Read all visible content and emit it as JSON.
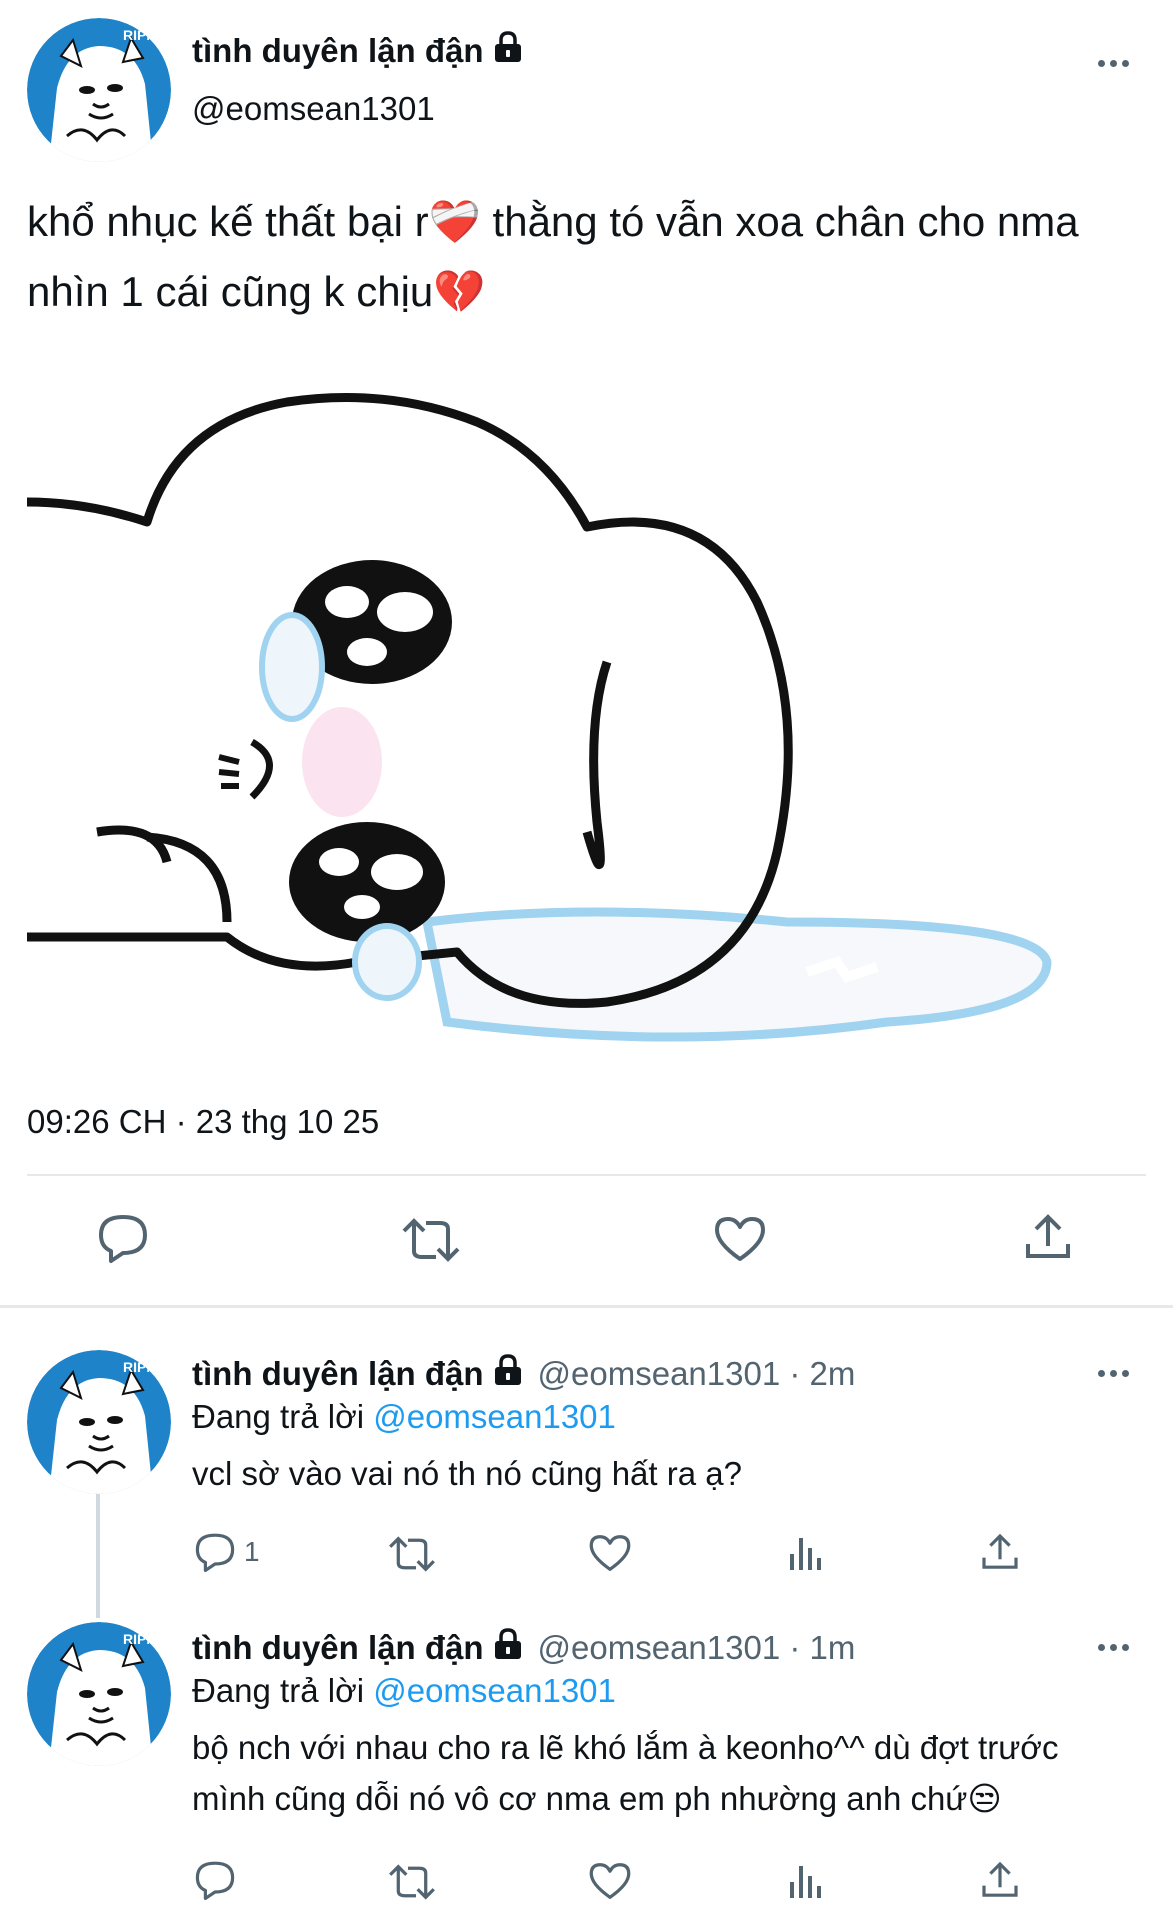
{
  "main_tweet": {
    "display_name": "tình duyên lận đận",
    "handle": "@eomsean1301",
    "avatar_text": "RIPN",
    "text_line1": "khổ nhục kế thất bại r❤️‍🩹 thằng tó vẫn xoa chân cho nma",
    "text_line2": "nhìn 1 cái cũng k chịu💔",
    "timestamp": "09:26 CH · 23 thg 10 25"
  },
  "replies": [
    {
      "display_name": "tình duyên lận đận",
      "handle_time": "@eomsean1301 · 2m",
      "replying_prefix": "Đang trả lời",
      "replying_to": "@eomsean1301",
      "text_line1": "vcl sờ vào vai nó th nó cũng hất ra ạ?",
      "text_line2": "",
      "reply_count": "1"
    },
    {
      "display_name": "tình duyên lận đận",
      "handle_time": "@eomsean1301 · 1m",
      "replying_prefix": "Đang trả lời",
      "replying_to": "@eomsean1301",
      "text_line1": "bộ nch với nhau cho ra lẽ khó lắm à keonho^^ dù đợt trước",
      "text_line2": "mình cũng dỗi nó vô cơ nma em ph nhường anh chứ😒",
      "reply_count": ""
    }
  ],
  "icons": {
    "reply": "reply-icon",
    "retweet": "retweet-icon",
    "like": "heart-icon",
    "views": "views-icon",
    "share": "share-icon",
    "more": "more-icon",
    "lock": "lock-icon"
  },
  "colors": {
    "text": "#0f1419",
    "secondary": "#536471",
    "link": "#1d9bf0",
    "avatar_bg": "#1e83c8",
    "tear": "#9fd3f0"
  }
}
